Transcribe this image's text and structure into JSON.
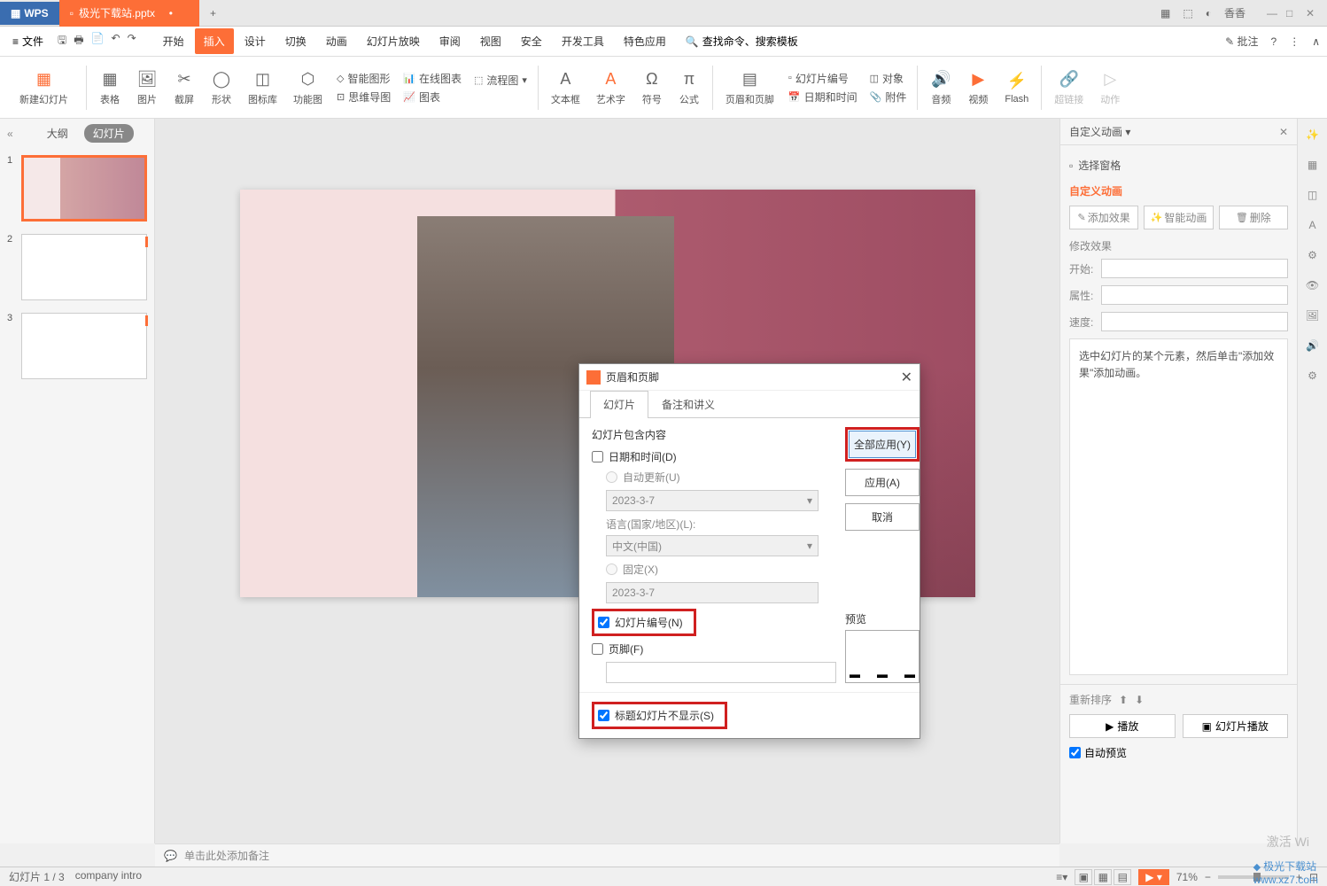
{
  "titlebar": {
    "logo": "WPS",
    "filename": "极光下载站.pptx",
    "user": "香香"
  },
  "menu": {
    "file": "文件",
    "tabs": [
      "开始",
      "插入",
      "设计",
      "切换",
      "动画",
      "幻灯片放映",
      "审阅",
      "视图",
      "安全",
      "开发工具",
      "特色应用"
    ],
    "active_tab": "插入",
    "search": "查找命令、搜索模板",
    "annotate": "批注"
  },
  "ribbon": {
    "new_slide": "新建幻灯片",
    "table": "表格",
    "picture": "图片",
    "screenshot": "截屏",
    "shape": "形状",
    "icon_lib": "图标库",
    "func_chart": "功能图",
    "smart_graphic": "智能图形",
    "online_chart": "在线图表",
    "flowchart": "流程图",
    "mindmap": "思维导图",
    "chart": "图表",
    "textbox": "文本框",
    "wordart": "艺术字",
    "symbol": "符号",
    "formula": "公式",
    "header_footer": "页眉和页脚",
    "slide_number": "幻灯片编号",
    "datetime": "日期和时间",
    "object": "对象",
    "attachment": "附件",
    "audio": "音频",
    "video": "视频",
    "flash": "Flash",
    "hyperlink": "超链接",
    "action": "动作"
  },
  "left_panel": {
    "outline": "大纲",
    "slides": "幻灯片",
    "slide_nums": [
      "1",
      "2",
      "3"
    ]
  },
  "right_panel": {
    "title": "自定义动画",
    "select_pane": "选择窗格",
    "heading": "自定义动画",
    "add_effect": "添加效果",
    "smart_anim": "智能动画",
    "delete": "删除",
    "modify_title": "修改效果",
    "start_label": "开始:",
    "prop_label": "属性:",
    "speed_label": "速度:",
    "hint": "选中幻灯片的某个元素，然后单击\"添加效果\"添加动画。",
    "reorder": "重新排序",
    "play": "播放",
    "slideshow": "幻灯片播放",
    "autoplay": "自动预览"
  },
  "notes": {
    "placeholder": "单击此处添加备注"
  },
  "statusbar": {
    "slide_info": "幻灯片 1 / 3",
    "theme": "company intro",
    "zoom": "71%",
    "activate": "激活 Wi"
  },
  "dialog": {
    "title": "页眉和页脚",
    "tab_slide": "幻灯片",
    "tab_notes": "备注和讲义",
    "section": "幻灯片包含内容",
    "datetime": "日期和时间(D)",
    "auto_update": "自动更新(U)",
    "date_value": "2023-3-7",
    "lang_label": "语言(国家/地区)(L):",
    "lang_value": "中文(中国)",
    "fixed": "固定(X)",
    "fixed_value": "2023-3-7",
    "slide_number": "幻灯片编号(N)",
    "footer": "页脚(F)",
    "title_hide": "标题幻灯片不显示(S)",
    "apply_all": "全部应用(Y)",
    "apply": "应用(A)",
    "cancel": "取消",
    "preview": "预览"
  },
  "watermark": {
    "site": "极光下载站",
    "url": "www.xz7.com"
  }
}
